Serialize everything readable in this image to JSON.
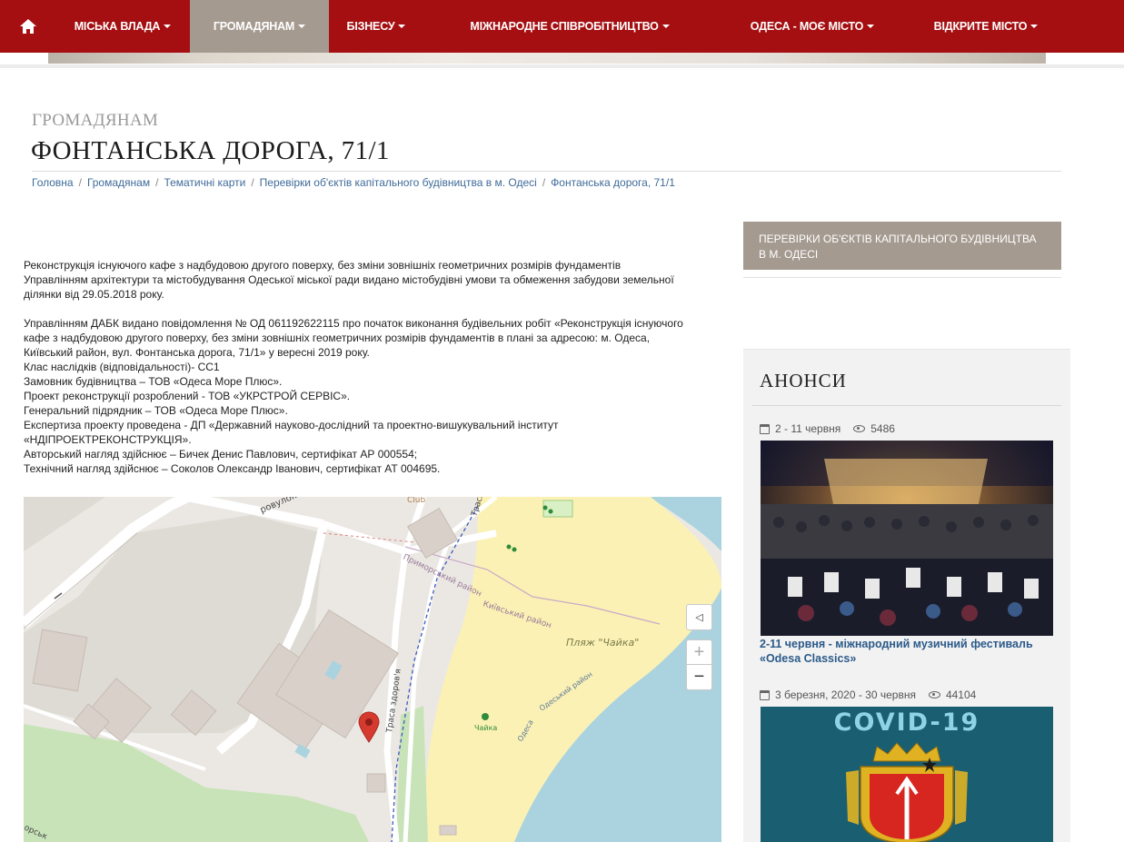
{
  "nav": {
    "items": [
      {
        "label": "МІСЬКА ВЛАДА"
      },
      {
        "label": "ГРОМАДЯНАМ"
      },
      {
        "label": "БІЗНЕСУ"
      },
      {
        "label": "МІЖНАРОДНЕ СПІВРОБІТНИЦТВО"
      },
      {
        "label": "ОДЕСА - МОЄ МІСТО"
      },
      {
        "label": "ВІДКРИТЕ МІСТО"
      }
    ],
    "active_index": 1
  },
  "header": {
    "section": "ГРОМАДЯНАМ",
    "title": "ФОНТАНСЬКА ДОРОГА, 71/1"
  },
  "breadcrumb": [
    "Головна",
    "Громадянам",
    "Тематичні карти",
    "Перевірки об'єктів капітального будівництва в м. Одесі",
    "Фонтанська дорога, 71/1"
  ],
  "article": {
    "para1": [
      "Реконструкція існуючого кафе з надбудовою другого поверху, без зміни зовнішніх геометричних розмірів фундаментів",
      "Управлінням архітектури та містобудування Одеської міської ради видано містобудівні умови та обмеження забудови земельної",
      "ділянки від 29.05.2018 року."
    ],
    "para2": [
      "Управлінням ДАБК видано повідомлення № ОД 061192622115 про початок виконання будівельних робіт «Реконструкція існуючого",
      "кафе з надбудовою другого поверху, без зміни зовнішніх геометричних розмірів фундаментів в плані за адресою: м. Одеса,",
      "Київський район, вул. Фонтанська дорога, 71/1» у вересні 2019 року.",
      "Клас наслідків (відповідальності)- СС1",
      "Замовник будівництва – ТОВ «Одеса Море Плюс».",
      "Проект реконструкції розроблений - ТОВ «УКРСТРОЙ СЕРВІС».",
      "Генеральний підрядник – ТОВ «Одеса Море Плюс».",
      "Експертиза проекту проведена - ДП «Державний науково-дослідний та проектно-вишукувальний інститут",
      "«НДІПРОЕКТРЕКОНСТРУКЦІЯ».",
      "Авторський нагляд здійснює – Бичек Денис Павлович, сертифікат АР 000554;",
      "Технічний нагляд здійснює – Соколов Олександр Іванович, сертифікат АТ 004695."
    ]
  },
  "map": {
    "labels": {
      "street_top": "ровулок",
      "club": "Club",
      "trasa_top": "Траса",
      "primorskyi": "Приморський район",
      "kyivskyi": "Київський район",
      "beach": "Пляж \"Чайка\"",
      "trasa_zdorovya": "Траса здоров'я",
      "chaika": "Чайка",
      "odesa": "Одеса",
      "odesa_district": "Одеський район",
      "bottom_left": "орськ"
    },
    "zoom_in": "+",
    "zoom_out": "−",
    "locate": "◁"
  },
  "sidebar": {
    "header": "ПЕРЕВІРКИ ОБ'ЄКТІВ КАПІТАЛЬНОГО БУДІВНИЦТВА В М. ОДЕСІ",
    "anons_title": "АНОНСИ",
    "news": [
      {
        "date": "2 - 11 червня",
        "views": "5486",
        "title": "2-11 червня - міжнародний музичний фестиваль «Odesa Classics»"
      },
      {
        "date": "3 березня, 2020 - 30 червня",
        "views": "44104",
        "image_text": "COVID-19"
      }
    ]
  },
  "colors": {
    "nav_bg": "#a50f12",
    "nav_active": "#a59a90",
    "link": "#2b5a8a"
  }
}
